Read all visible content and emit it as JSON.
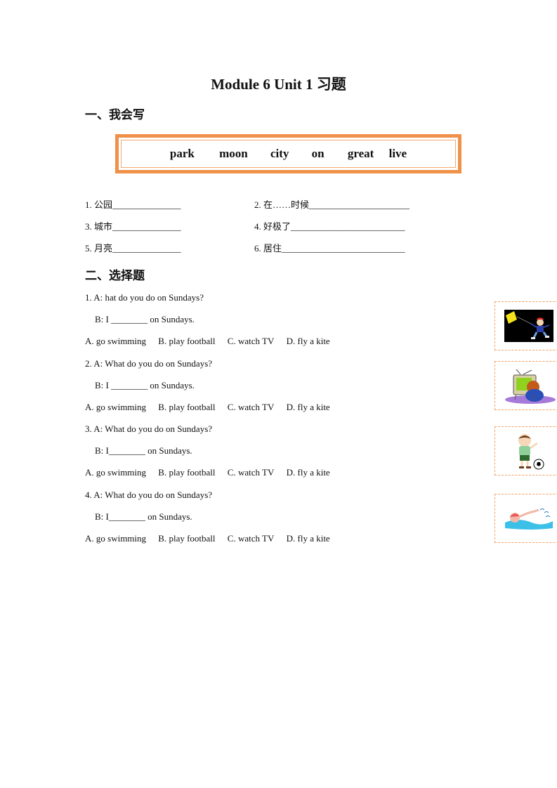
{
  "document": {
    "title": "Module 6 Unit 1  习题"
  },
  "section1": {
    "heading": "一、我会写",
    "word_bank": [
      "park",
      "moon",
      "city",
      "on",
      "great",
      "live"
    ],
    "items": [
      {
        "label": "1.  公园",
        "blank": "_______________"
      },
      {
        "label": "2.  在……时候",
        "blank": "______________________"
      },
      {
        "label": "3.  城市",
        "blank": "_______________"
      },
      {
        "label": "4.  好极了",
        "blank": "_________________________"
      },
      {
        "label": "5.  月亮",
        "blank": "_______________"
      },
      {
        "label": "6.  居住",
        "blank": "___________________________"
      }
    ]
  },
  "section2": {
    "heading": "二、选择题",
    "questions": [
      {
        "a": "1. A: hat do you do on Sundays?",
        "b": "B: I ________ on Sundays.",
        "options": [
          "A. go swimming",
          "B. play football",
          "C. watch TV",
          "D. fly a kite"
        ]
      },
      {
        "a": "2. A: What do you do on Sundays?",
        "b": "B: I ________ on Sundays.",
        "options": [
          "A. go swimming",
          "B. play football",
          "C. watch TV",
          "D. fly a kite"
        ]
      },
      {
        "a": "3. A: What do you do on Sundays?",
        "b": "B: I________ on Sundays.",
        "options": [
          "A. go swimming",
          "B. play football",
          "C. watch TV",
          "D. fly a kite"
        ]
      },
      {
        "a": "4. A: What do you do on Sundays?",
        "b": "B: I________ on Sundays.",
        "options": [
          "A. go swimming",
          "B. play football",
          "C. watch TV",
          "D. fly a kite"
        ]
      }
    ]
  },
  "pictures": [
    {
      "icon": "fly-kite-picture-icon"
    },
    {
      "icon": "watch-tv-picture-icon"
    },
    {
      "icon": "play-football-picture-icon"
    },
    {
      "icon": "go-swimming-picture-icon"
    }
  ],
  "colors": {
    "box_border": "#f0914a",
    "dashed_frame": "#f3a060"
  }
}
